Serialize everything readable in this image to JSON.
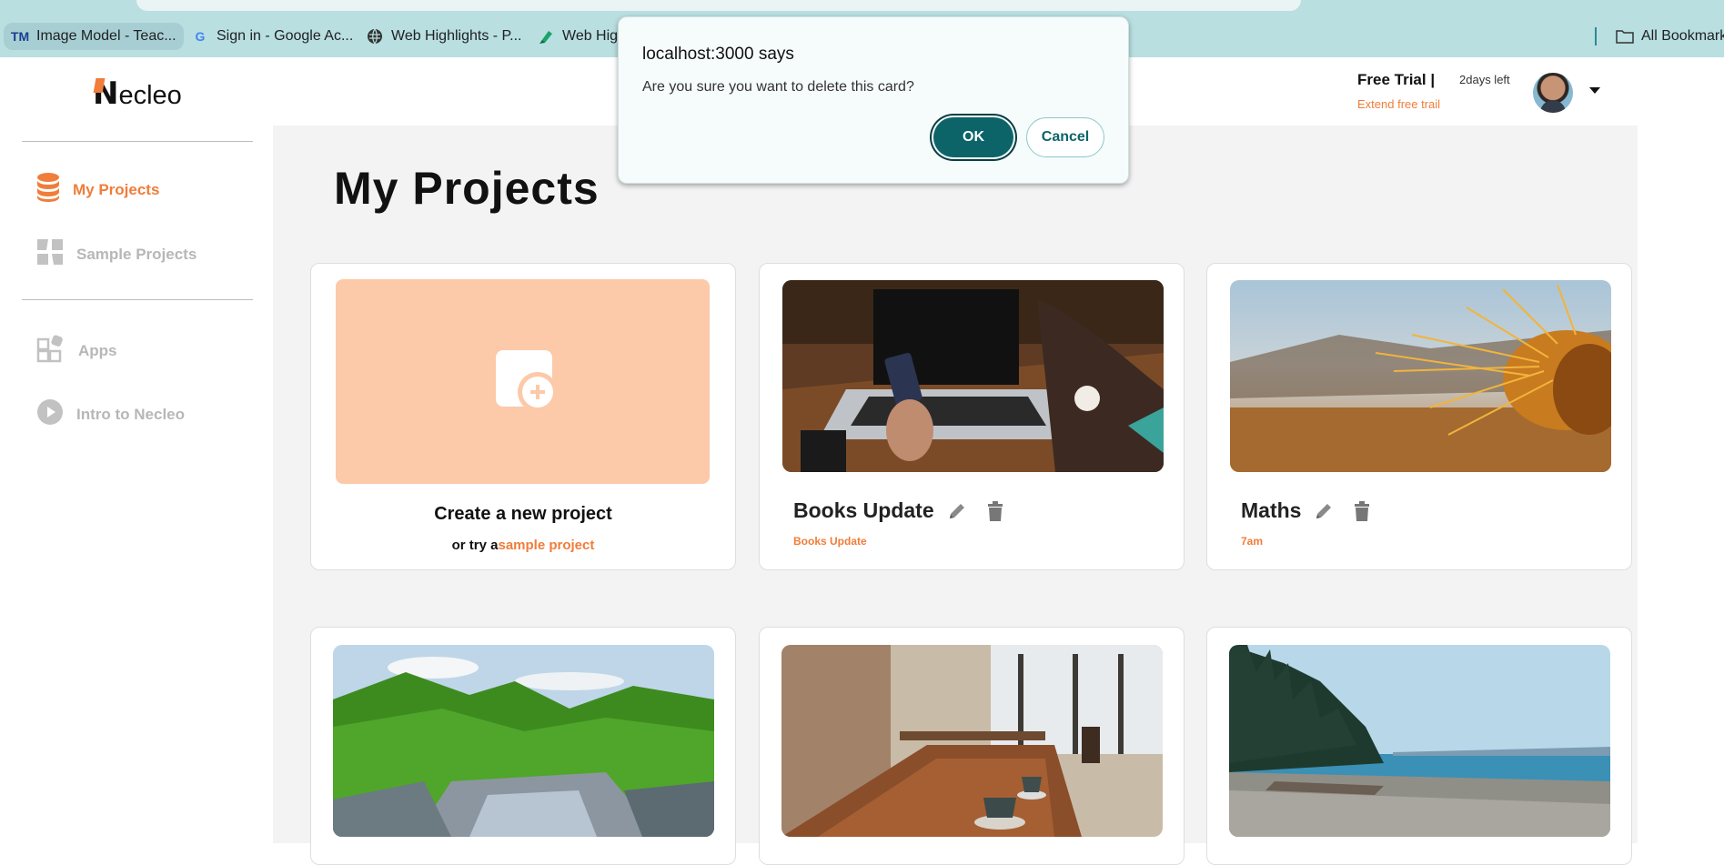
{
  "browser": {
    "bookmarks": [
      {
        "label": "Image Model - Teac...",
        "icon": "tm-favicon"
      },
      {
        "label": "Sign in - Google Ac...",
        "icon": "google-favicon"
      },
      {
        "label": "Web Highlights - P...",
        "icon": "globe-favicon"
      },
      {
        "label": "Web High",
        "icon": "highlighter-favicon"
      }
    ],
    "all_bookmarks": "All Bookmark"
  },
  "sidebar": {
    "logo_n": "N",
    "logo_rest": "ecleo",
    "items": [
      {
        "label": "My Projects",
        "icon": "database-icon",
        "active": true
      },
      {
        "label": "Sample Projects",
        "icon": "grid-icon",
        "active": false
      },
      {
        "label": "Apps",
        "icon": "apps-icon",
        "active": false
      },
      {
        "label": "Intro to Necleo",
        "icon": "play-icon",
        "active": false
      }
    ]
  },
  "header": {
    "free_trial": "Free Trial  |",
    "days_left": "2days left",
    "extend": "Extend free trail"
  },
  "main": {
    "title": "My Projects",
    "create": {
      "title": "Create a new project",
      "sub_prefix": "or try a",
      "sub_link": "sample project"
    },
    "cards": [
      {
        "title": "Books Update",
        "subtitle": "Books Update",
        "image": "laptop-phone"
      },
      {
        "title": "Maths",
        "subtitle": "7am",
        "image": "cactus-closeup"
      }
    ],
    "row2_images": [
      "forest-river",
      "cafe-table",
      "beach-shore"
    ]
  },
  "dialog": {
    "title": "localhost:3000 says",
    "message": "Are you sure you want to delete this card?",
    "ok": "OK",
    "cancel": "Cancel"
  },
  "colors": {
    "accent": "#f07d3a",
    "browser_bar": "#b9dfe1",
    "dialog_ok": "#0c6469",
    "create_box": "#fcc9a9"
  }
}
